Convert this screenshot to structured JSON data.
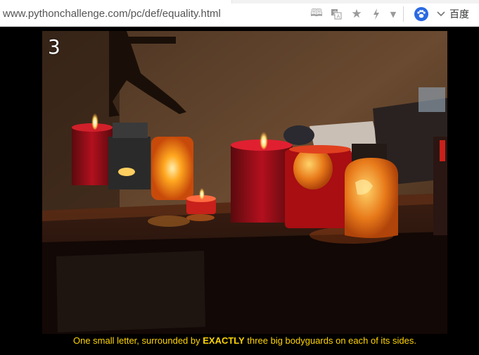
{
  "browser": {
    "url": "www.pythonchallenge.com/pc/def/equality.html",
    "search_engine": "百度",
    "icons": [
      "reader-icon",
      "translate-icon",
      "star-icon",
      "bolt-icon",
      "caret-down-icon",
      "paw-icon",
      "chevron-down-icon"
    ]
  },
  "page": {
    "photo_number": "3",
    "caption_before": "One small letter, surrounded by ",
    "caption_emphasis": "EXACTLY",
    "caption_after": " three big bodyguards on each of its sides.",
    "colors": {
      "caption": "#ffd400",
      "background": "#000000"
    }
  }
}
